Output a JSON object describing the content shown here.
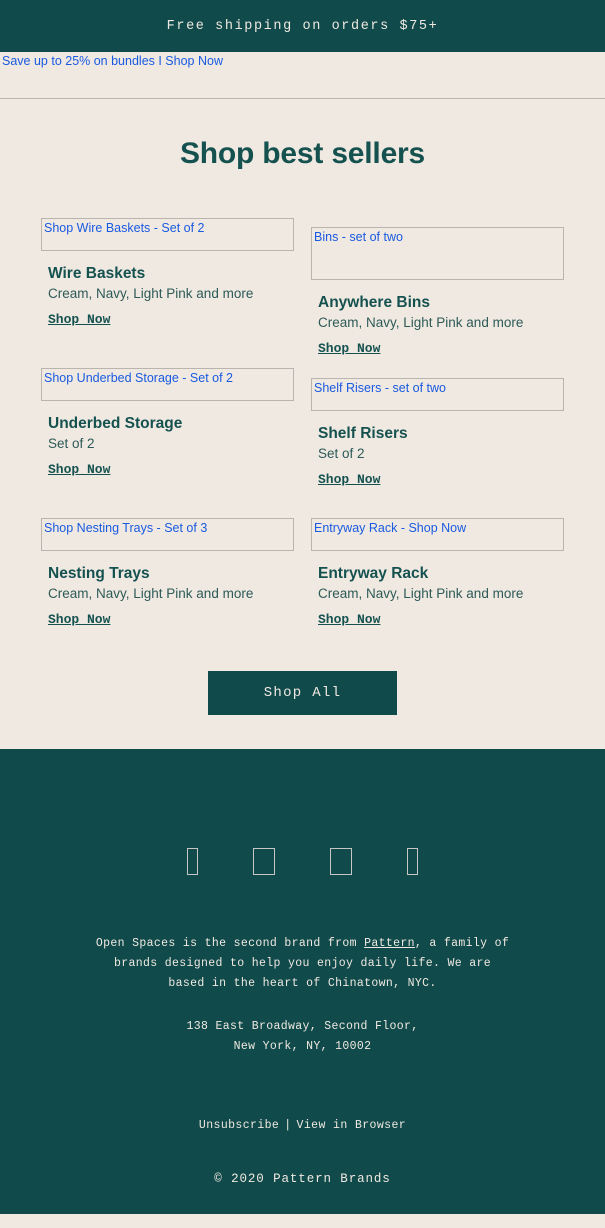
{
  "announcement": {
    "text": "Free shipping on orders $75+"
  },
  "promo": {
    "alt_text": "Save up to 25% on bundles I Shop Now"
  },
  "main": {
    "title": "Shop best sellers",
    "products": [
      {
        "image_alt": "Shop Wire Baskets - Set of 2",
        "name": "Wire Baskets",
        "description": "Cream, Navy, Light Pink and more",
        "link_label": "Shop Now"
      },
      {
        "image_alt": "Bins - set of two",
        "name": "Anywhere Bins",
        "description": "Cream, Navy, Light Pink and more",
        "link_label": "Shop Now"
      },
      {
        "image_alt": "Shop Underbed Storage - Set of 2",
        "name": "Underbed Storage",
        "description": "Set of 2",
        "link_label": "Shop Now"
      },
      {
        "image_alt": "Shelf Risers - set of two",
        "name": "Shelf Risers",
        "description": "Set of 2",
        "link_label": "Shop Now"
      },
      {
        "image_alt": "Shop Nesting Trays - Set of 3",
        "name": "Nesting Trays",
        "description": "Cream, Navy, Light Pink and more",
        "link_label": "Shop Now"
      },
      {
        "image_alt": "Entryway Rack - Shop Now",
        "name": "Entryway Rack",
        "description": "Cream, Navy, Light Pink and more",
        "link_label": "Shop Now"
      }
    ],
    "cta_label": "Shop All"
  },
  "footer": {
    "social_icons": [
      "social-icon-1",
      "social-icon-2",
      "social-icon-3",
      "social-icon-4"
    ],
    "blurb_part_1": "Open Spaces is the second brand from ",
    "blurb_link": "Pattern",
    "blurb_part_2": ", a family of brands designed to help you enjoy daily life. We are based in the heart of Chinatown, NYC.",
    "address_line_1": "138 East Broadway, Second Floor,",
    "address_line_2": "New York, NY, 10002",
    "unsubscribe_label": "Unsubscribe",
    "separator": "|",
    "view_in_browser_label": "View in Browser",
    "copyright": "© 2020 Pattern Brands"
  },
  "colors": {
    "teal": "#104a4a",
    "cream": "#efe9e2",
    "heading_teal": "#15514f",
    "alt_link_blue": "#1a5ae0"
  }
}
